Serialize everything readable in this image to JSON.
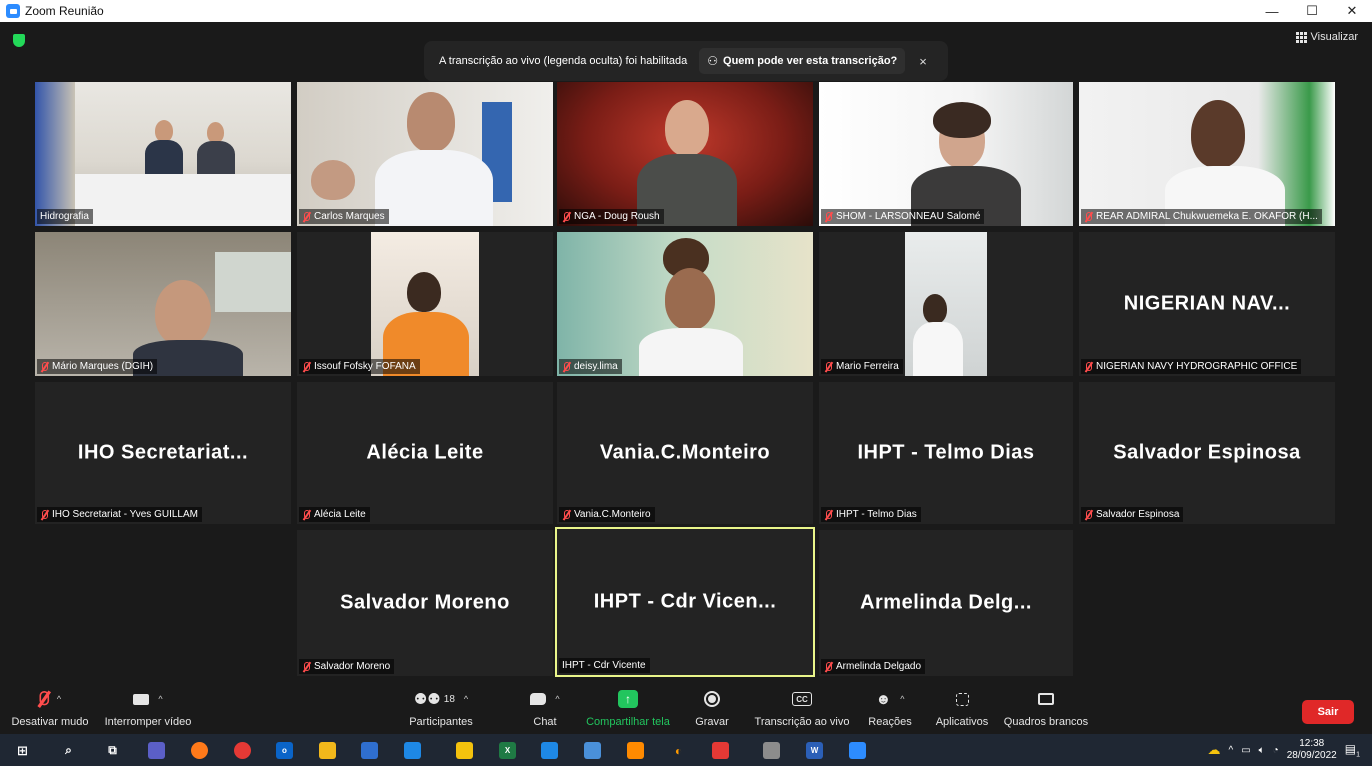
{
  "window": {
    "title": "Zoom Reunião",
    "controls": [
      "—",
      "☐",
      "✕"
    ]
  },
  "topbar": {
    "view_label": "Visualizar"
  },
  "banner": {
    "text": "A transcrição ao vivo (legenda oculta) foi habilitada",
    "button": "Quem pode ver esta transcrição?",
    "close": "×"
  },
  "tiles": [
    {
      "label": "Hidrografia",
      "muted": false
    },
    {
      "label": "Carlos Marques",
      "muted": true
    },
    {
      "label": "NGA - Doug Roush",
      "muted": true
    },
    {
      "label": "SHOM - LARSONNEAU Salomé",
      "muted": true
    },
    {
      "label": "REAR ADMIRAL Chukwuemeka E. OKAFOR (H...",
      "muted": true
    },
    {
      "label": "Mário Marques (DGIH)",
      "muted": true
    },
    {
      "label": "Issouf Fofsky FOFANA",
      "muted": true
    },
    {
      "label": "deisy.lima",
      "muted": true
    },
    {
      "label": "Mario Ferreira",
      "muted": true
    },
    {
      "big": "NIGERIAN NAV...",
      "label": "NIGERIAN NAVY HYDROGRAPHIC OFFICE",
      "muted": true
    },
    {
      "big": "IHO Secretariat...",
      "label": "IHO Secretariat - Yves GUILLAM",
      "muted": true
    },
    {
      "big": "Alécia Leite",
      "label": "Alécia Leite",
      "muted": true
    },
    {
      "big": "Vania.C.Monteiro",
      "label": "Vania.C.Monteiro",
      "muted": true
    },
    {
      "big": "IHPT - Telmo Dias",
      "label": "IHPT - Telmo Dias",
      "muted": true
    },
    {
      "big": "Salvador Espinosa",
      "label": "Salvador Espinosa",
      "muted": true
    },
    {
      "big": "Salvador Moreno",
      "label": "Salvador Moreno",
      "muted": true
    },
    {
      "big": "IHPT - Cdr Vicen...",
      "label": "IHPT - Cdr Vicente",
      "muted": false
    },
    {
      "big": "Armelinda Delg...",
      "label": "Armelinda Delgado",
      "muted": true
    }
  ],
  "toolbar": {
    "mute": "Desativar mudo",
    "video": "Interromper vídeo",
    "participants": "Participantes",
    "participants_count": "18",
    "chat": "Chat",
    "share": "Compartilhar tela",
    "record": "Gravar",
    "transcription": "Transcrição ao vivo",
    "cc": "CC",
    "reactions": "Reações",
    "apps": "Aplicativos",
    "whiteboards": "Quadros brancos",
    "leave": "Sair"
  },
  "taskbar": {
    "time": "12:38",
    "date": "28/09/2022",
    "notifications": "1"
  },
  "colors": {
    "share_green": "#22c55e",
    "leave_red": "#e02828",
    "active_speaker": "#e9f58a",
    "muted_red": "#ff4d4d"
  }
}
